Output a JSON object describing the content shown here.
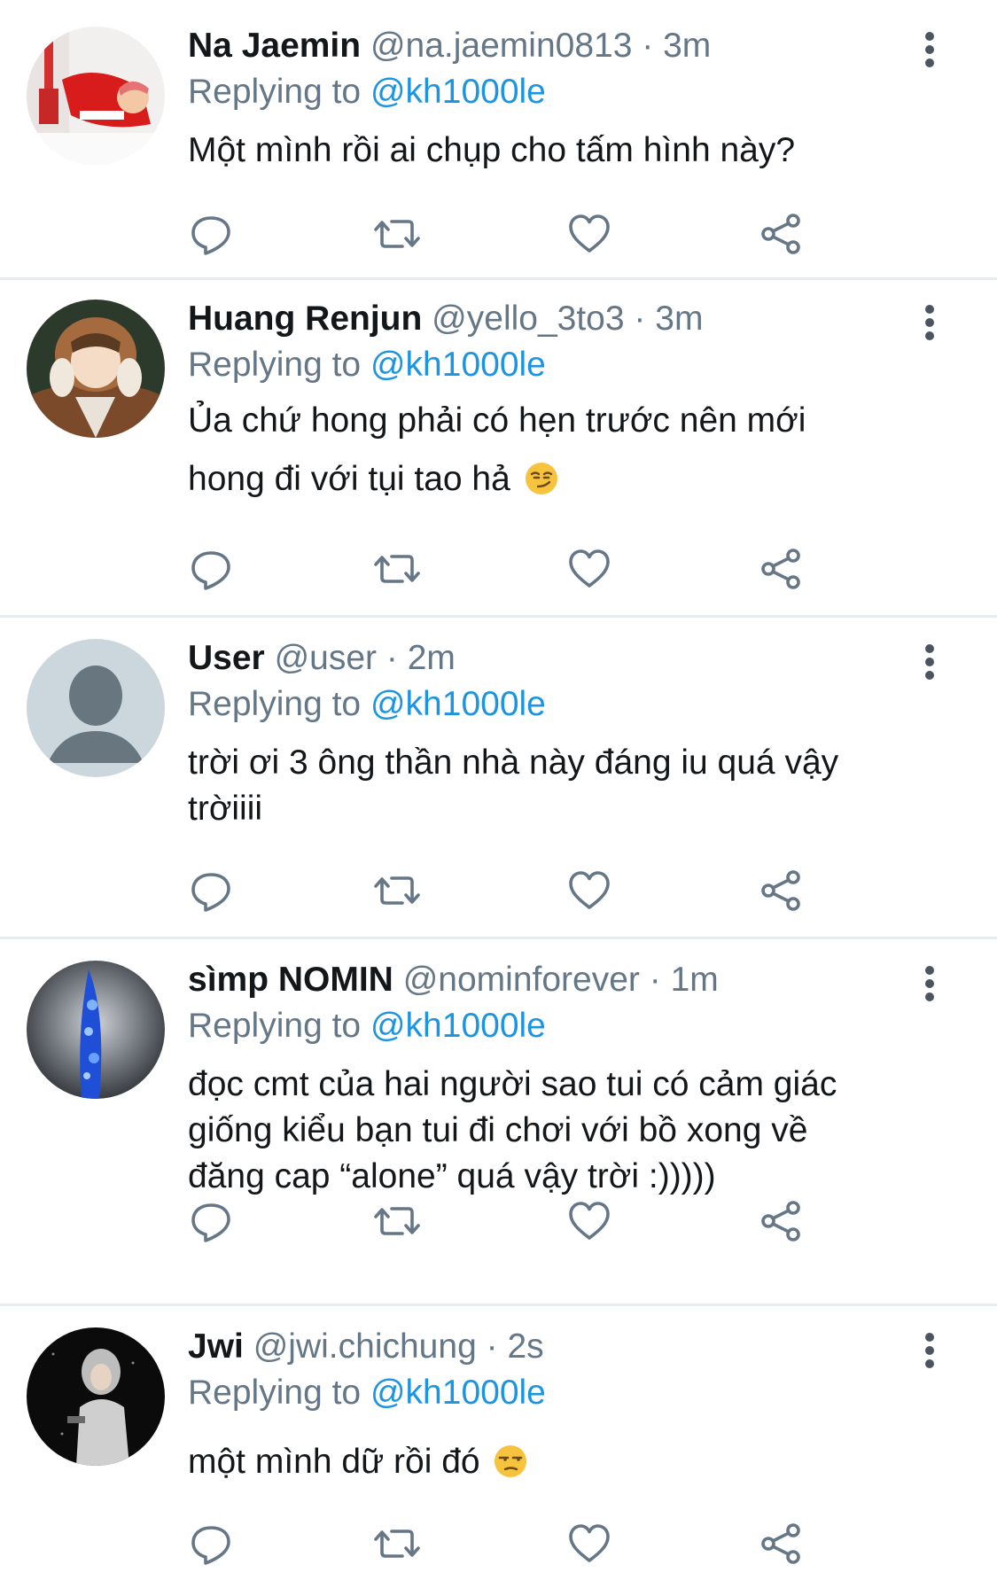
{
  "tweets": [
    {
      "name": "Na Jaemin",
      "handle": "@na.jaemin0813",
      "separator": "·",
      "time": "3m",
      "replying_prefix": "Replying to",
      "replying_to": "@kh1000le",
      "text": "Một mình rồi ai chụp cho tấm hình này?"
    },
    {
      "name": "Huang Renjun",
      "handle": "@yello_3to3",
      "separator": "·",
      "time": "3m",
      "replying_prefix": "Replying to",
      "replying_to": "@kh1000le",
      "text_line1": "Ủa chứ hong phải có hẹn trước nên mới",
      "text_line2": "hong đi với tụi tao hả",
      "emoji": "smirking-face-emoji"
    },
    {
      "name": "User",
      "handle": "@user",
      "separator": "·",
      "time": "2m",
      "replying_prefix": "Replying to",
      "replying_to": "@kh1000le",
      "text_line1": "trời ơi 3 ông thần nhà này đáng iu quá vậy",
      "text_line2": "trờiiii"
    },
    {
      "name": "sìmp NOMIN",
      "handle": "@nominforever",
      "separator": "·",
      "time": "1m",
      "replying_prefix": "Replying to",
      "replying_to": "@kh1000le",
      "text_line1": "đọc cmt của hai người sao tui có cảm giác",
      "text_line2": "giống kiểu bạn tui đi chơi với bồ xong về",
      "text_line3": "đăng cap “alone” quá vậy trời :)))))"
    },
    {
      "name": "Jwi",
      "handle": "@jwi.chichung",
      "separator": "·",
      "time": "2s",
      "replying_prefix": "Replying to",
      "replying_to": "@kh1000le",
      "text": "một mình dữ rồi đó",
      "emoji": "unamused-face-emoji"
    }
  ],
  "icons": {
    "reply": "reply-icon",
    "retweet": "retweet-icon",
    "like": "heart-icon",
    "share": "share-icon",
    "more": "more-vertical-icon"
  },
  "colors": {
    "text": "#14171a",
    "secondary": "#657786",
    "link": "#1b95e0",
    "divider": "#e6ecf0",
    "icon": "#657786"
  }
}
